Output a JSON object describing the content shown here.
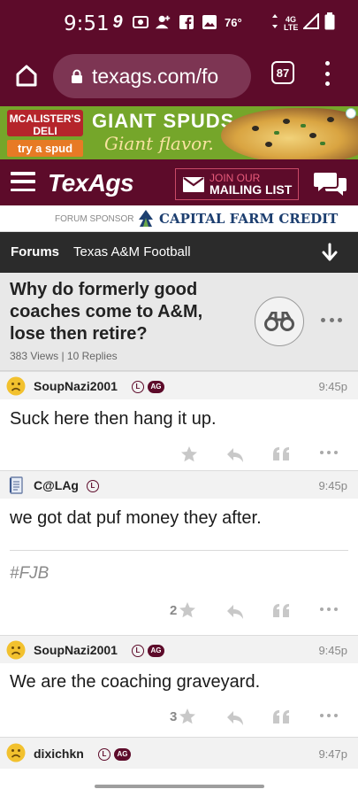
{
  "status_bar": {
    "time": "9:51",
    "notif_glyphs": [
      "9",
      "◎",
      "👤",
      "f",
      "▲"
    ],
    "battery_pct": "76°",
    "network": "4G LTE"
  },
  "browser": {
    "url": "texags.com/fo",
    "tab_count": "87"
  },
  "ad": {
    "brand": "MCALISTER'S DELI",
    "cta": "try a spud",
    "headline": "GIANT SPUDS.",
    "tagline": "Giant flavor."
  },
  "site": {
    "logo": "TexAgs",
    "mailing_line1": "JOIN OUR",
    "mailing_line2": "MAILING LIST"
  },
  "sponsor": {
    "label": "FORUM SPONSOR",
    "name": "CAPITAL FARM CREDIT"
  },
  "breadcrumb": {
    "forums": "Forums",
    "section": "Texas A&M Football"
  },
  "thread": {
    "title": "Why do formerly good coaches come to A&M, lose then retire?",
    "meta": "383 Views | 10 Replies"
  },
  "badges": {
    "letter": "L",
    "ag": "AG"
  },
  "posts": [
    {
      "user": "SoupNazi2001",
      "time": "9:45p",
      "body": "Suck here then hang it up.",
      "star_count": "",
      "signature": ""
    },
    {
      "user": "C@LAg",
      "time": "9:45p",
      "body": "we got dat puf money they after.",
      "star_count": "2",
      "signature": "#FJB"
    },
    {
      "user": "SoupNazi2001",
      "time": "9:45p",
      "body": "We are the coaching graveyard.",
      "star_count": "3",
      "signature": ""
    },
    {
      "user": "dixichkn",
      "time": "9:47p",
      "body": "",
      "star_count": "",
      "signature": ""
    }
  ],
  "colors": {
    "maroon": "#5d0b2a",
    "breadcrumb_bg": "#2b2b2b",
    "thread_bg": "#e8e8e8"
  }
}
